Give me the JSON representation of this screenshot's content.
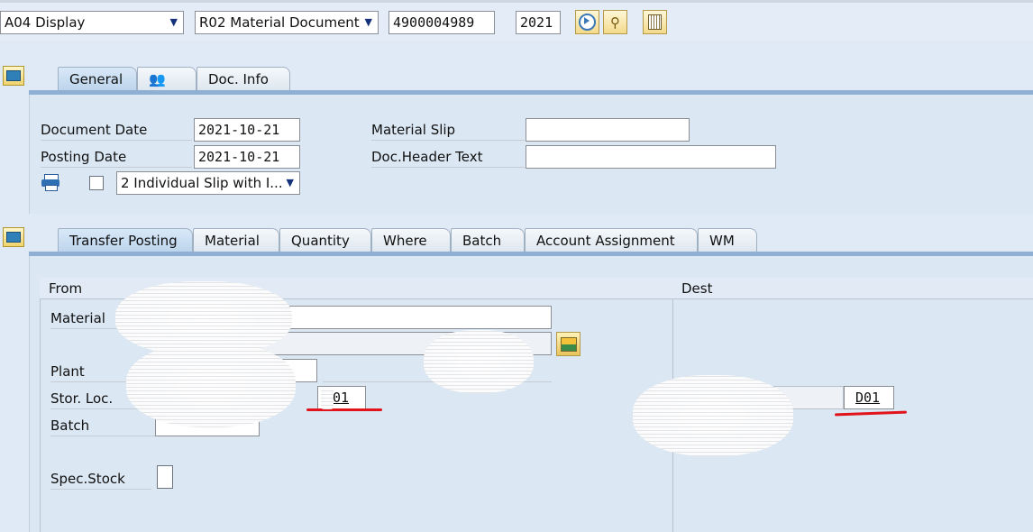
{
  "toolbar": {
    "action": "A04 Display",
    "reference": "R02 Material Document",
    "doc_number": "4900004989",
    "year": "2021",
    "buttons": [
      "execute-icon",
      "find-icon",
      "calculator-icon"
    ]
  },
  "header": {
    "tabs": [
      "General",
      "",
      "Doc. Info"
    ],
    "document_date_label": "Document Date",
    "document_date": "2021-10-21",
    "posting_date_label": "Posting Date",
    "posting_date": "2021-10-21",
    "material_slip_label": "Material Slip",
    "material_slip": "",
    "doc_header_text_label": "Doc.Header Text",
    "doc_header_text": "",
    "print_option": "2 Individual Slip with I..."
  },
  "item": {
    "tabs": [
      "Transfer Posting",
      "Material",
      "Quantity",
      "Where",
      "Batch",
      "Account Assignment",
      "WM"
    ],
    "from_label": "From",
    "dest_label": "Dest",
    "material_label": "Material",
    "plant_label": "Plant",
    "stor_loc_label": "Stor. Loc.",
    "batch_label": "Batch",
    "spec_stock_label": "Spec.Stock",
    "from_stor_loc": "01",
    "batch_value": "",
    "dest_stor_loc": "D01"
  },
  "colors": {
    "background": "#dfeaf6",
    "tab_strip": "#8fb0d3",
    "annotation": "#e0141a"
  }
}
